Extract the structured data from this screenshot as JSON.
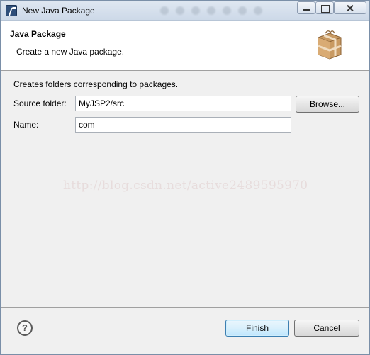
{
  "window": {
    "title": "New Java Package",
    "icon": "eclipse-icon"
  },
  "banner": {
    "title": "Java Package",
    "description": "Create a new Java package.",
    "icon": "package-icon"
  },
  "form": {
    "intro": "Creates folders corresponding to packages.",
    "source_folder_label": "Source folder:",
    "source_folder_value": "MyJSP2/src",
    "browse_label": "Browse...",
    "name_label": "Name:",
    "name_value": "com"
  },
  "watermark": "http://blog.csdn.net/active2489595970",
  "footer": {
    "help_icon": "help-icon",
    "finish_label": "Finish",
    "cancel_label": "Cancel"
  },
  "colors": {
    "dialog_bg": "#f0f0f0",
    "banner_bg": "#ffffff",
    "default_button_border": "#3c7fb1"
  }
}
